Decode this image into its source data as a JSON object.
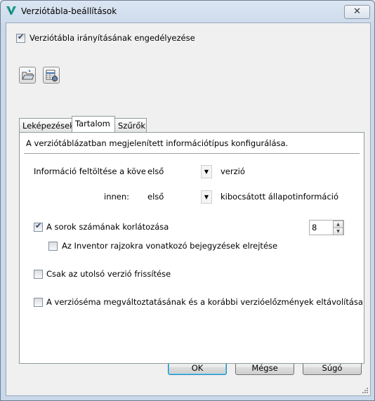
{
  "window": {
    "title": "Verziótábla-beállítások",
    "close_glyph": "✕",
    "icon": "app-v-logo-icon",
    "accent": "#1a9a8f"
  },
  "enable": {
    "label": "Verziótábla irányításának engedélyezése",
    "checked": true
  },
  "toolbar": {
    "import_icon": "import-folder-icon",
    "export_icon": "table-settings-icon"
  },
  "tabs": [
    {
      "label": "Leképezések",
      "active": false
    },
    {
      "label": "Tartalom",
      "active": true
    },
    {
      "label": "Szűrők",
      "active": false
    }
  ],
  "content": {
    "description": "A verziótáblázatban megjelenített információtípus konfigurálása.",
    "fill_label": "Információ feltöltése a következő",
    "fill_select": "első",
    "fill_suffix": "verzió",
    "from_label": "innen:",
    "from_select": "első",
    "from_suffix": "kibocsátott állapotinformáció",
    "limit_rows": {
      "label": "A sorok számának korlátozása",
      "checked": true,
      "value": "8"
    },
    "hide_inventor": {
      "label": "Az Inventor rajzokra vonatkozó bejegyzések elrejtése",
      "checked": false
    },
    "latest_only": {
      "label": "Csak az utolsó verzió frissítése",
      "checked": false
    },
    "remove_history": {
      "label": "A verzióséma megváltoztatásának és a korábbi verzióelőzmények eltávolítása",
      "checked": false
    }
  },
  "buttons": {
    "ok": "OK",
    "cancel": "Mégse",
    "help": "Súgó"
  },
  "checkmark": "✔",
  "dropdown_arrow": "▼",
  "spin_up": "▲",
  "spin_down": "▼"
}
